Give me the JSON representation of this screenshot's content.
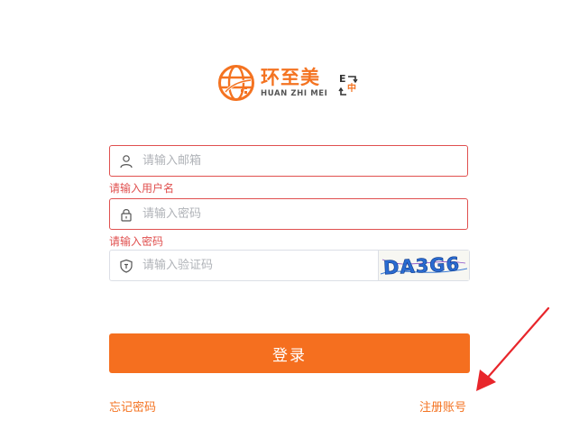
{
  "brand": {
    "name_cn": "环至美",
    "name_en": "HUAN ZHI MEI",
    "accent": "#f47321"
  },
  "lang_switch": {
    "en": "E",
    "cn": "中",
    "icon": "language-switch-icon"
  },
  "form": {
    "email": {
      "placeholder": "请输入邮箱",
      "value": "",
      "error": "请输入用户名",
      "icon": "user-icon"
    },
    "password": {
      "placeholder": "请输入密码",
      "value": "",
      "error": "请输入密码",
      "icon": "lock-icon"
    },
    "code": {
      "placeholder": "请输入验证码",
      "value": "",
      "icon": "shield-icon",
      "captcha_text": "DA3G6"
    },
    "submit_label": "登录",
    "error_color": "#e0504f",
    "button_color": "#f56f1f"
  },
  "links": {
    "forgot": "忘记密码",
    "register": "注册账号"
  },
  "annotation": {
    "arrow_color": "#e8262b"
  }
}
